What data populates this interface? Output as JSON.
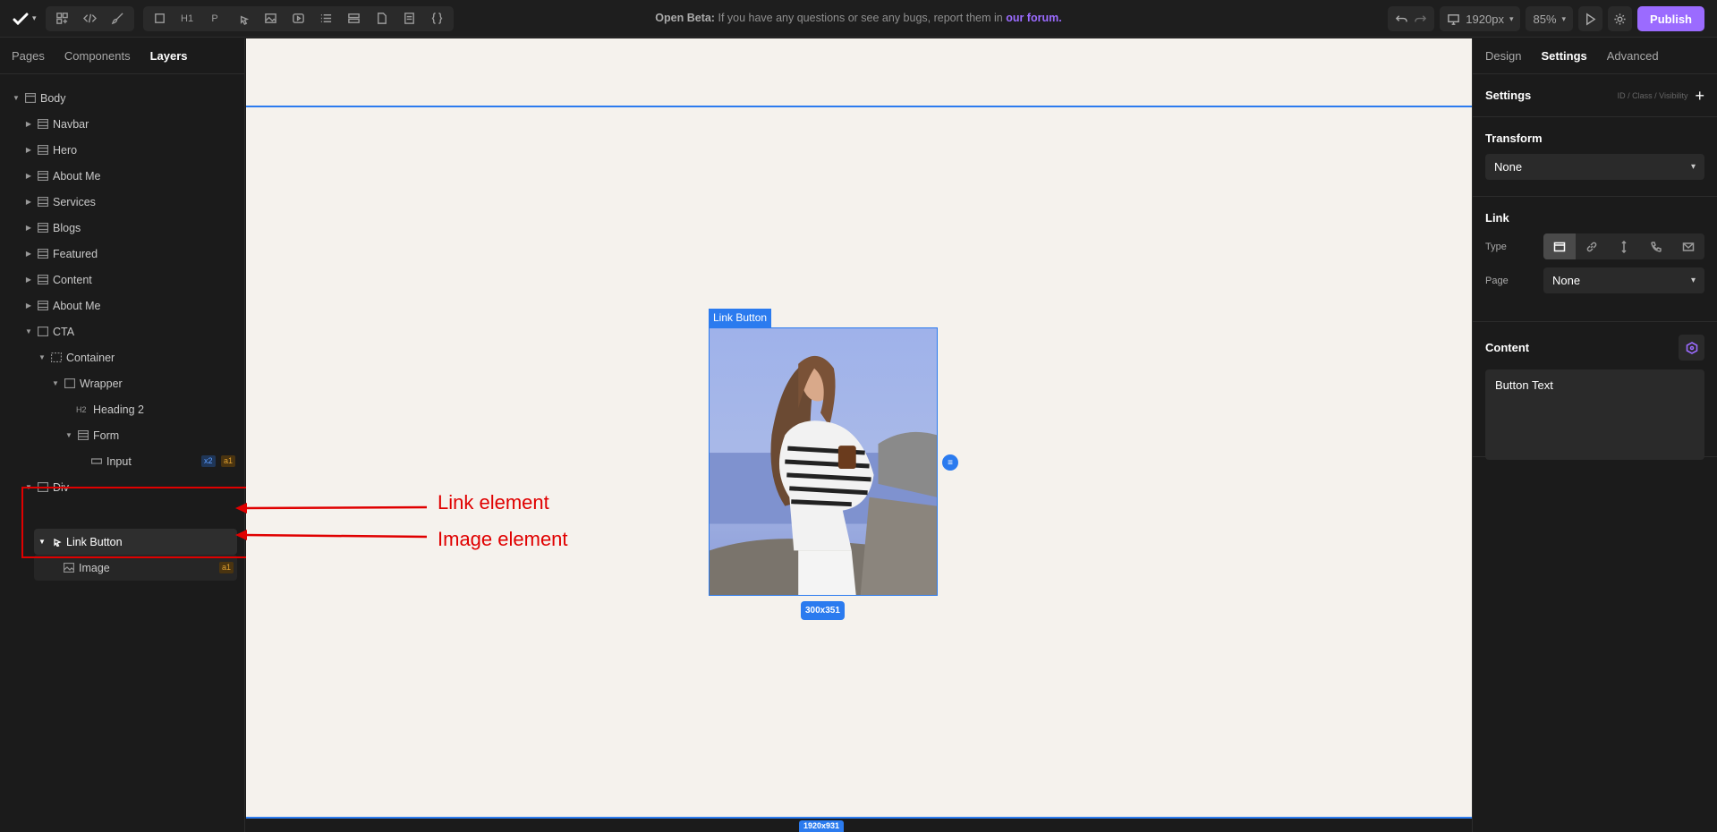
{
  "topbar": {
    "notice_bold": "Open Beta:",
    "notice_text": "If you have any questions or see any bugs, report them in",
    "notice_link": "our forum.",
    "breakpoint": "1920px",
    "zoom": "85%",
    "publish_label": "Publish",
    "tools": [
      "H1",
      "P"
    ]
  },
  "left_tabs": [
    "Pages",
    "Components",
    "Layers"
  ],
  "layers": [
    {
      "label": "Body"
    },
    {
      "label": "Navbar"
    },
    {
      "label": "Hero"
    },
    {
      "label": "About Me"
    },
    {
      "label": "Services"
    },
    {
      "label": "Blogs"
    },
    {
      "label": "Featured"
    },
    {
      "label": "Content"
    },
    {
      "label": "About Me"
    },
    {
      "label": "CTA"
    },
    {
      "label": "Container"
    },
    {
      "label": "Wrapper"
    },
    {
      "label": "Heading 2",
      "tag": "H2"
    },
    {
      "label": "Form"
    },
    {
      "label": "Input",
      "badges": [
        "x2",
        "a1"
      ]
    },
    {
      "label": "Div"
    },
    {
      "label": "Link Button"
    },
    {
      "label": "Image",
      "badges": [
        "a1"
      ]
    }
  ],
  "canvas": {
    "selected_label": "Link Button",
    "selection_size": "300x351",
    "frame_size": "1920x931"
  },
  "annotations": {
    "link": "Link element",
    "image": "Image element"
  },
  "right_tabs": [
    "Design",
    "Settings",
    "Advanced"
  ],
  "settings": {
    "title": "Settings",
    "meta": "ID / Class / Visibility",
    "transform_title": "Transform",
    "transform_value": "None",
    "link_title": "Link",
    "type_label": "Type",
    "page_label": "Page",
    "page_value": "None",
    "content_title": "Content",
    "button_text": "Button Text"
  },
  "colors": {
    "accent": "#2b7bef",
    "brand": "#9b6bff",
    "annotation": "#e00000"
  }
}
